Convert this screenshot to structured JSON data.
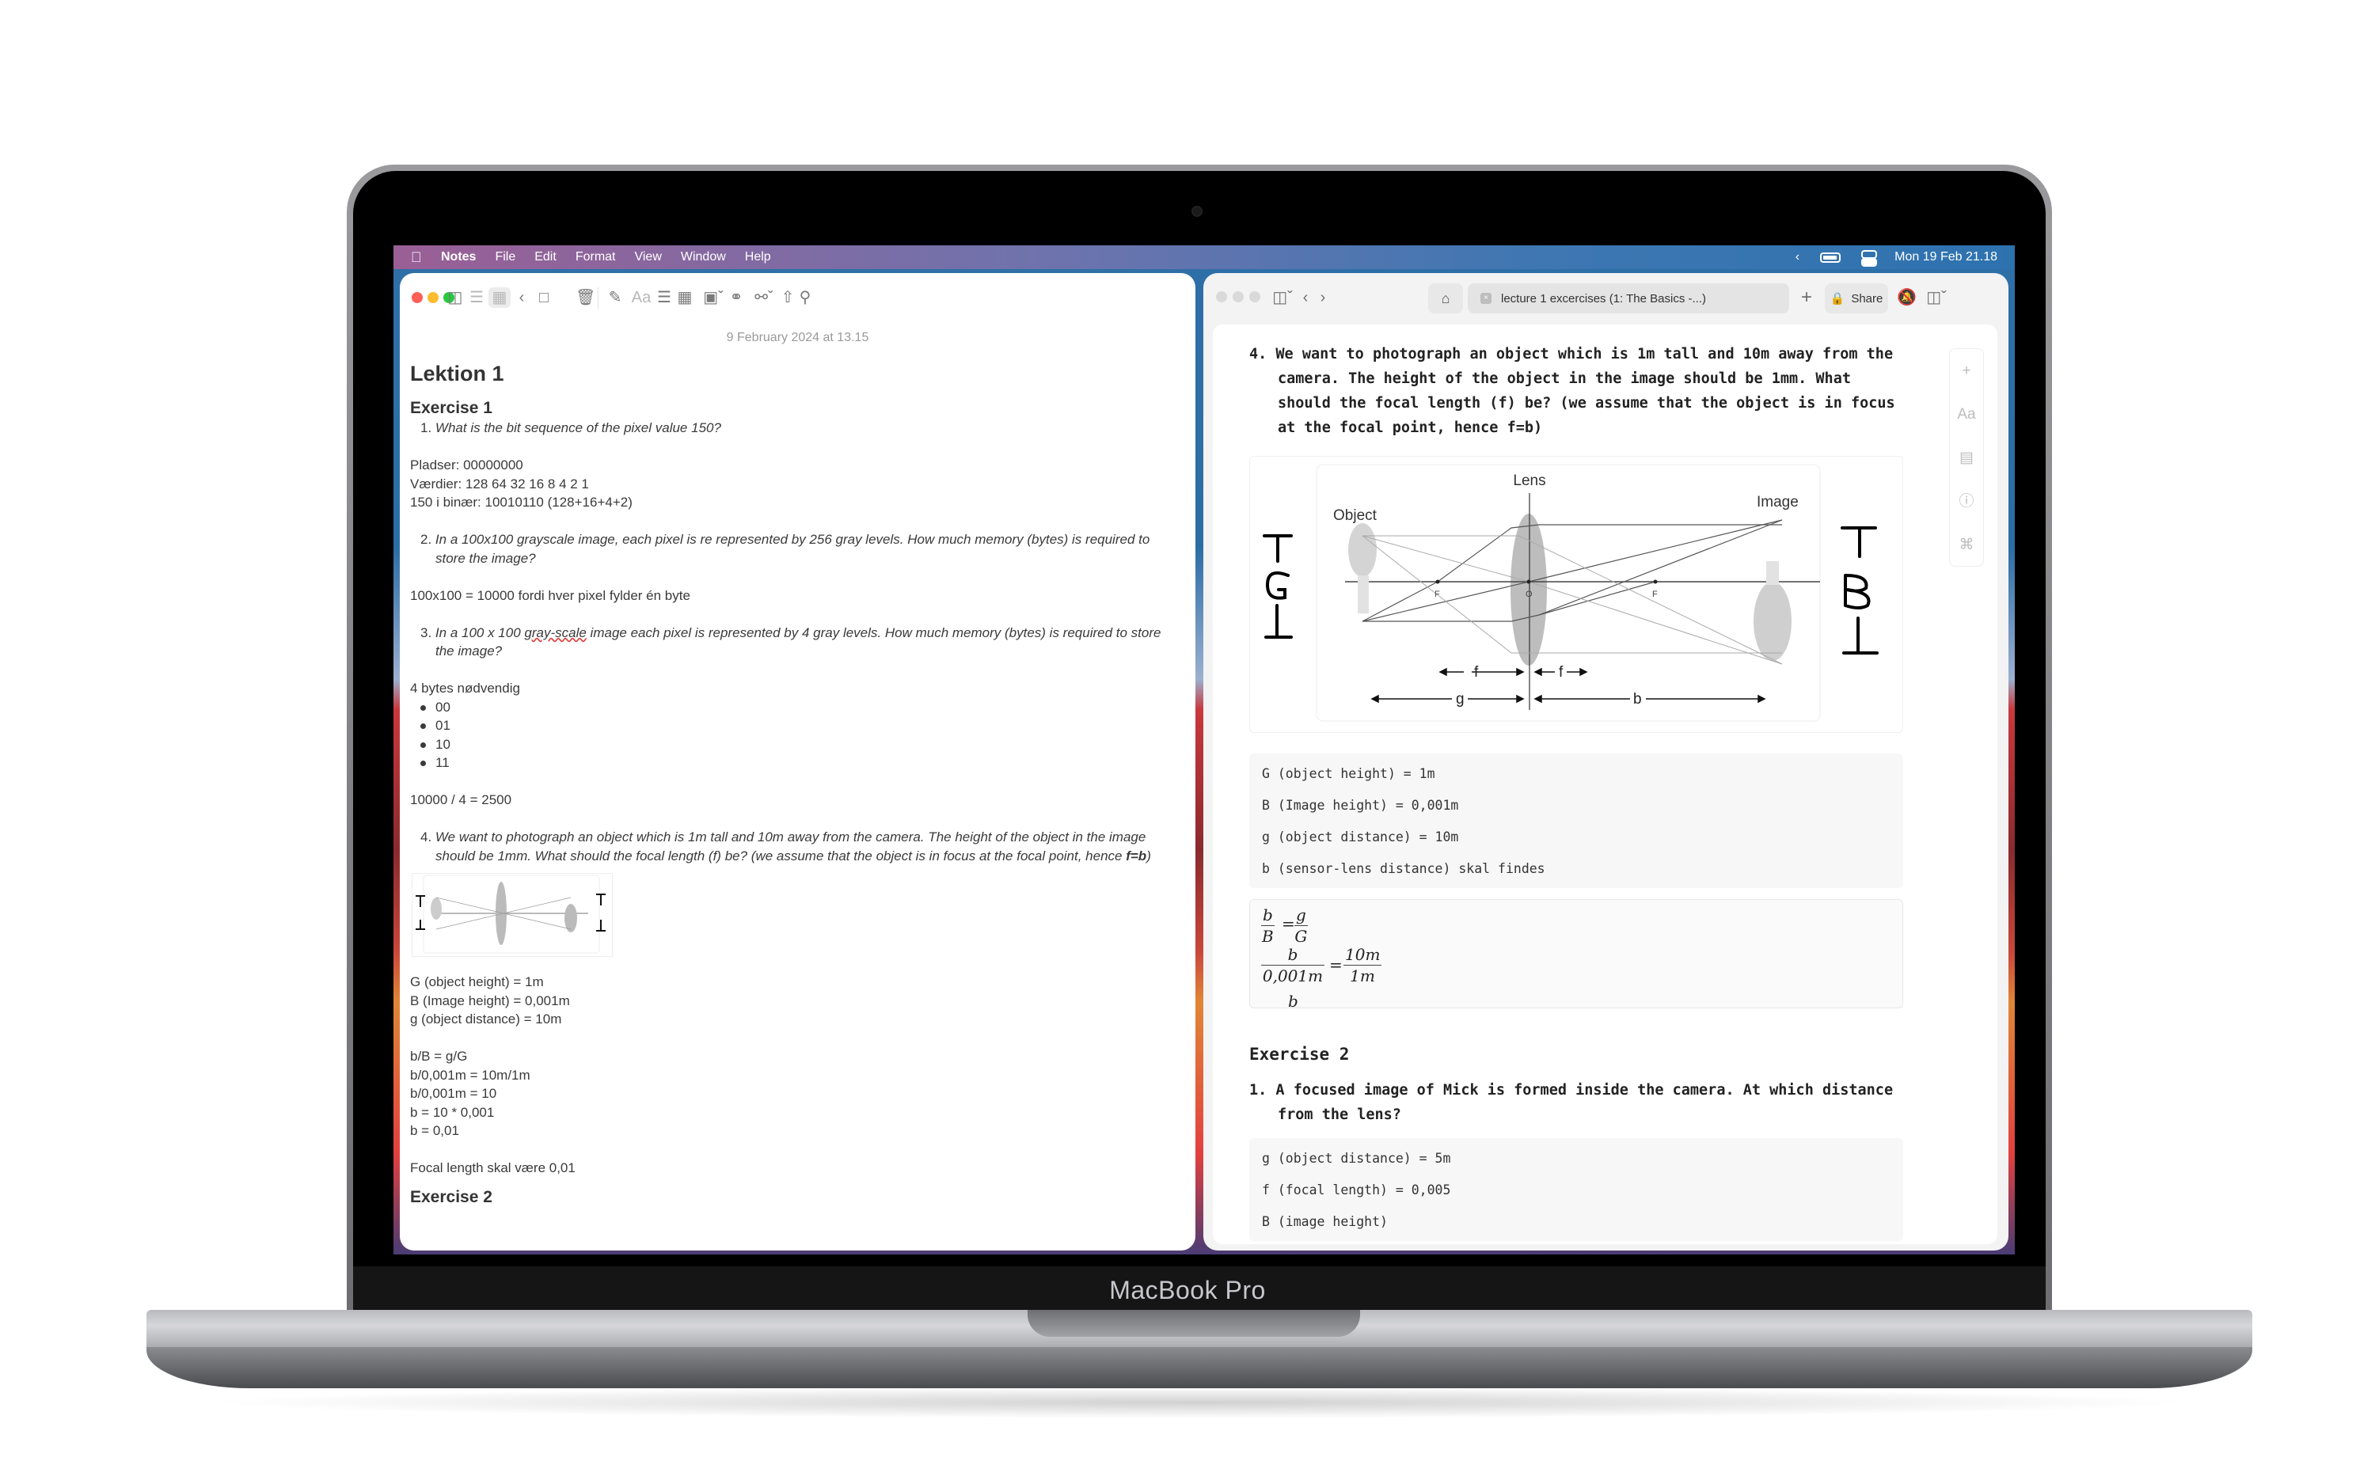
{
  "device": {
    "label": "MacBook Pro"
  },
  "menubar": {
    "app_name": "Notes",
    "menus": [
      "File",
      "Edit",
      "Format",
      "View",
      "Window",
      "Help"
    ],
    "datetime": "Mon 19 Feb  21.18"
  },
  "notes_window": {
    "toolbar": {
      "icons": [
        "sidebar-toggle-icon",
        "list-view-icon",
        "gallery-view-icon",
        "back-icon",
        "attachments-icon",
        "trash-icon",
        "compose-icon",
        "text-format-icon",
        "checklist-icon",
        "table-icon",
        "media-icon",
        "collaborate-icon",
        "lock-icon",
        "share-icon",
        "search-icon"
      ],
      "text_format_label": "Aa"
    },
    "date": "9 February 2024 at 13.15",
    "title": "Lektion 1",
    "exercise1_heading": "Exercise 1",
    "q1": {
      "num": "1.",
      "text": "What is the bit sequence of the pixel value 150?"
    },
    "a1": [
      "Pladser: 00000000",
      "Værdier: 128 64 32 16 8 4 2 1",
      "150 i binær: 10010110 (128+16+4+2)"
    ],
    "q2": {
      "num": "2.",
      "text": "In a 100x100 grayscale image, each pixel is re represented by 256 gray levels. How much memory (bytes) is required to store the image?"
    },
    "a2": "100x100 = 10000 fordi hver pixel fylder én byte",
    "q3": {
      "num": "3.",
      "pre": "In a 100 x 100 ",
      "misspelled": "gray-scale",
      "post": " image each pixel is represented by 4 gray levels. How much memory (bytes) is required to store the image?"
    },
    "a3_intro": "4 bytes nødvendig",
    "a3_bullets": [
      "00",
      "01",
      "10",
      "11"
    ],
    "a3_result": "10000 / 4 = 2500",
    "q4": {
      "num": "4.",
      "text": "We want to photograph an object which is 1m tall and 10m away from the camera. The height of the object in the image should be 1mm. What should the focal length (f) be? (we assume that the object is in focus at the focal point, hence ",
      "bold": "f=b",
      "close": ")"
    },
    "a4_givens": [
      "G (object height) = 1m",
      "B (Image height) = 0,001m",
      "g (object distance) = 10m"
    ],
    "a4_steps": [
      "b/B = g/G",
      "b/0,001m = 10m/1m",
      "b/0,001m = 10",
      "b = 10 * 0,001",
      "b = 0,01"
    ],
    "a4_conclusion": "Focal length skal være 0,01",
    "exercise2_heading": "Exercise 2"
  },
  "right_window": {
    "tab_title": "lecture 1 excercises (1: The Basics -...)",
    "share_label": "Share",
    "q4": {
      "num": "4.",
      "text": "We want to photograph an object which is 1m tall and 10m away from the camera. The height of the object in the image should be 1mm. What should the focal length (f) be? (we assume that the object is in focus at the focal point, hence f=b)"
    },
    "diagram": {
      "labels": {
        "lens": "Lens",
        "object": "Object",
        "image": "Image",
        "focal_left": "F",
        "center": "O",
        "focal_right": "F",
        "f1": "f",
        "f2": "f",
        "g": "g",
        "b": "b"
      },
      "handwritten_left": [
        "T",
        "G",
        "⊥"
      ],
      "handwritten_right": [
        "T",
        "B",
        "⊥"
      ]
    },
    "givens_code": [
      "G (object height) = 1m",
      "B (Image height) = 0,001m",
      "g (object distance) = 10m",
      "b (sensor-lens distance) skal findes"
    ],
    "math": {
      "eq1": {
        "lhs_num": "b",
        "lhs_den": "B",
        "rhs_num": "g",
        "rhs_den": "G"
      },
      "eq2": {
        "lhs_num": "b",
        "lhs_den": "0,001m",
        "rhs_num": "10m",
        "rhs_den": "1m"
      },
      "eq3_partial": "b",
      "equals": "="
    },
    "exercise2_heading": "Exercise 2",
    "ex2_q1": {
      "num": "1.",
      "text": "A focused image of Mick is formed inside the camera. At which distance from the lens?"
    },
    "ex2_givens": [
      "g (object distance) = 5m",
      "f (focal length) = 0,005",
      "B (image height)"
    ],
    "side_tools": [
      "+",
      "Aa",
      "▤",
      "ⓘ",
      "⌘"
    ]
  }
}
